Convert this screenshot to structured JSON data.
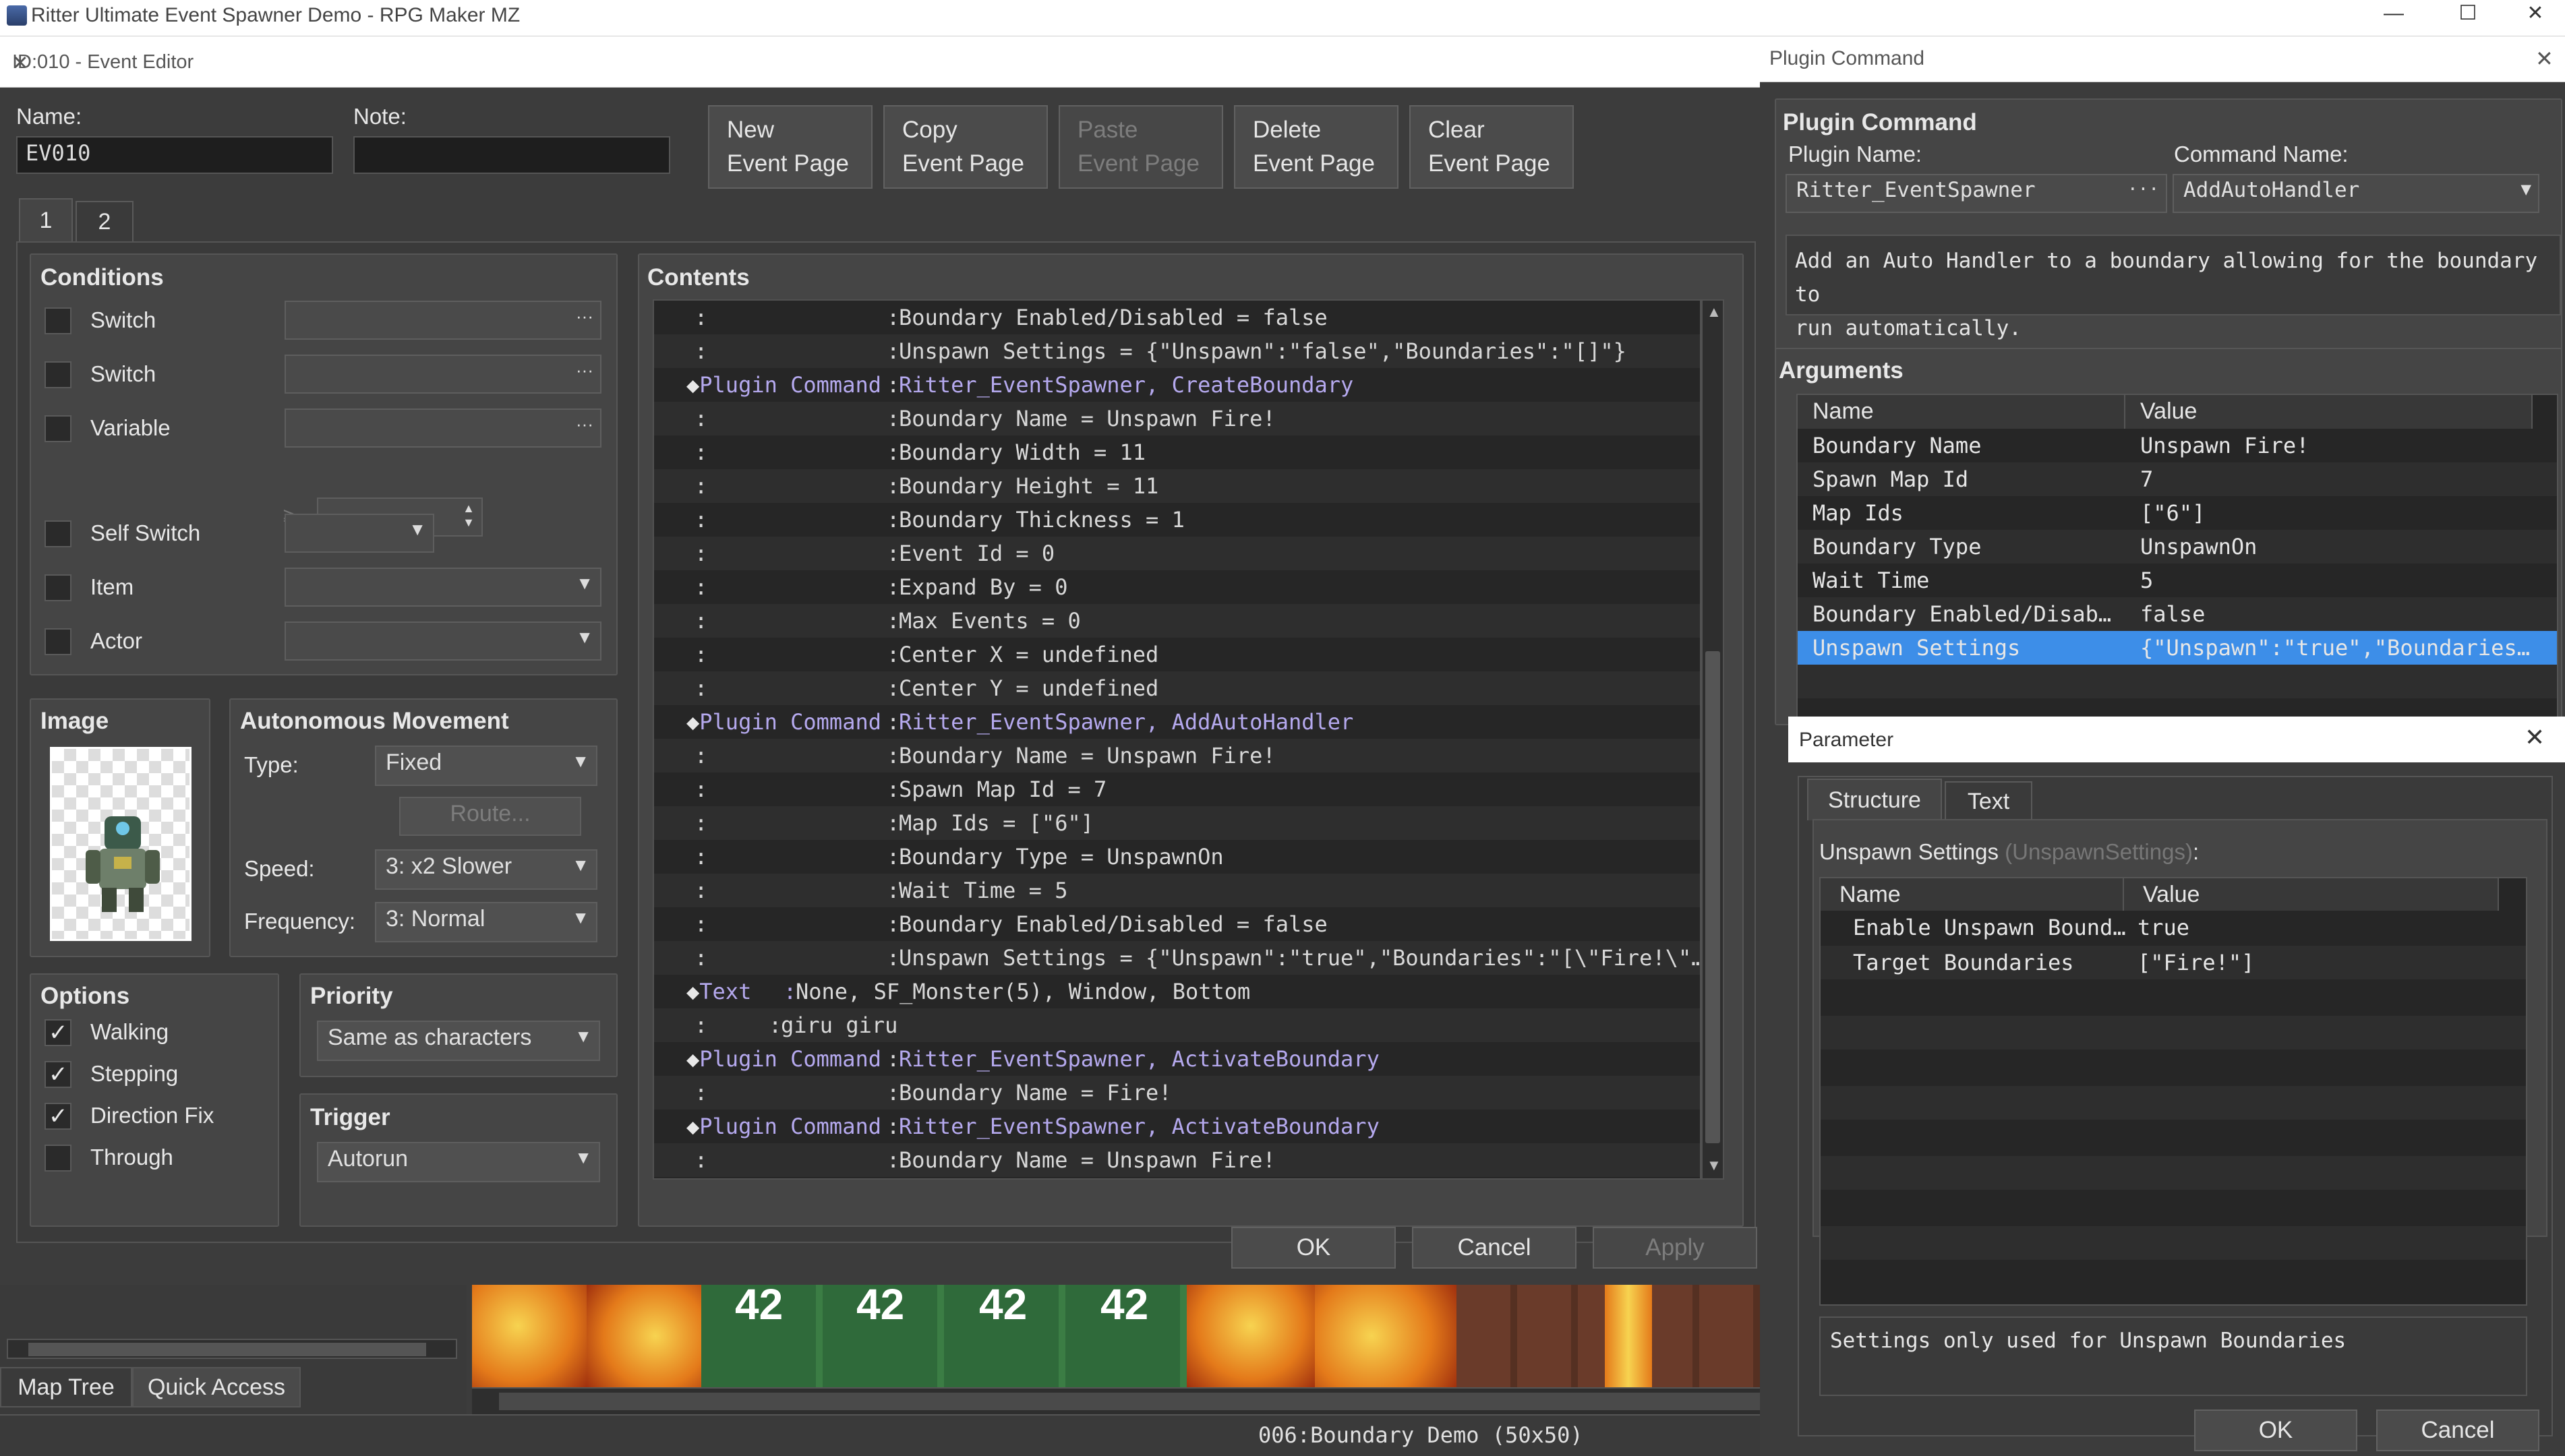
{
  "os_window": {
    "title": "Ritter Ultimate Event Spawner Demo - RPG Maker MZ",
    "minimize": "—",
    "maximize": "☐",
    "close": "✕"
  },
  "event_editor": {
    "title": "ID:010 - Event Editor",
    "close": "✕",
    "name_label": "Name:",
    "name_value": "EV010",
    "note_label": "Note:",
    "note_value": "",
    "page_buttons": [
      {
        "line1": "New",
        "line2": "Event Page",
        "enabled": true
      },
      {
        "line1": "Copy",
        "line2": "Event Page",
        "enabled": true
      },
      {
        "line1": "Paste",
        "line2": "Event Page",
        "enabled": false
      },
      {
        "line1": "Delete",
        "line2": "Event Page",
        "enabled": true
      },
      {
        "line1": "Clear",
        "line2": "Event Page",
        "enabled": true
      }
    ],
    "tabs": [
      "1",
      "2"
    ],
    "conditions": {
      "header": "Conditions",
      "items": [
        {
          "label": "Switch",
          "value": "",
          "icon": "ellipsis"
        },
        {
          "label": "Switch",
          "value": "",
          "icon": "ellipsis"
        },
        {
          "label": "Variable",
          "value": "",
          "icon": "ellipsis"
        },
        {
          "label": "Self Switch",
          "value": ""
        },
        {
          "label": "Item",
          "value": ""
        },
        {
          "label": "Actor",
          "value": ""
        }
      ],
      "variable_compare": "≥"
    },
    "image": {
      "header": "Image"
    },
    "autonomous_movement": {
      "header": "Autonomous Movement",
      "type_label": "Type:",
      "type_value": "Fixed",
      "route_button": "Route...",
      "speed_label": "Speed:",
      "speed_value": "3: x2 Slower",
      "frequency_label": "Frequency:",
      "frequency_value": "3: Normal"
    },
    "options": {
      "header": "Options",
      "items": [
        {
          "label": "Walking",
          "checked": true
        },
        {
          "label": "Stepping",
          "checked": true
        },
        {
          "label": "Direction Fix",
          "checked": true
        },
        {
          "label": "Through",
          "checked": false
        }
      ]
    },
    "priority": {
      "header": "Priority",
      "value": "Same as characters"
    },
    "trigger": {
      "header": "Trigger",
      "value": "Autorun"
    },
    "contents": {
      "header": "Contents",
      "rows": [
        {
          "kind": "arg",
          "text": "Boundary Enabled/Disabled = false"
        },
        {
          "kind": "arg",
          "text": "Unspawn Settings = {\"Unspawn\":\"false\",\"Boundaries\":\"[]\"}"
        },
        {
          "kind": "cmd",
          "cmd": "Plugin Command",
          "text": "Ritter_EventSpawner, CreateBoundary"
        },
        {
          "kind": "arg",
          "text": "Boundary Name = Unspawn Fire!"
        },
        {
          "kind": "arg",
          "text": "Boundary Width = 11"
        },
        {
          "kind": "arg",
          "text": "Boundary Height = 11"
        },
        {
          "kind": "arg",
          "text": "Boundary Thickness = 1"
        },
        {
          "kind": "arg",
          "text": "Event Id = 0"
        },
        {
          "kind": "arg",
          "text": "Expand By = 0"
        },
        {
          "kind": "arg",
          "text": "Max Events = 0"
        },
        {
          "kind": "arg",
          "text": "Center X = undefined"
        },
        {
          "kind": "arg",
          "text": "Center Y = undefined"
        },
        {
          "kind": "cmd",
          "cmd": "Plugin Command",
          "text": "Ritter_EventSpawner, AddAutoHandler"
        },
        {
          "kind": "arg",
          "text": "Boundary Name = Unspawn Fire!"
        },
        {
          "kind": "arg",
          "text": "Spawn Map Id = 7"
        },
        {
          "kind": "arg",
          "text": "Map Ids = [\"6\"]"
        },
        {
          "kind": "arg",
          "text": "Boundary Type = UnspawnOn"
        },
        {
          "kind": "arg",
          "text": "Wait Time = 5"
        },
        {
          "kind": "arg",
          "text": "Boundary Enabled/Disabled = false"
        },
        {
          "kind": "arg",
          "text": "Unspawn Settings = {\"Unspawn\":\"true\",\"Boundaries\":\"[\\\"Fire!\\\"…"
        },
        {
          "kind": "text",
          "cmd": "Text",
          "text": "None, SF_Monster(5), Window, Bottom"
        },
        {
          "kind": "textline",
          "text": "giru giru"
        },
        {
          "kind": "cmd",
          "cmd": "Plugin Command",
          "text": "Ritter_EventSpawner, ActivateBoundary"
        },
        {
          "kind": "arg",
          "text": "Boundary Name = Fire!"
        },
        {
          "kind": "cmd",
          "cmd": "Plugin Command",
          "text": "Ritter_EventSpawner, ActivateBoundary"
        },
        {
          "kind": "arg",
          "text": "Boundary Name = Unspawn Fire!"
        }
      ]
    },
    "ok": "OK",
    "cancel": "Cancel",
    "apply": "Apply"
  },
  "main_editor": {
    "tabs": [
      "Map Tree",
      "Quick Access"
    ],
    "tile_numbers": [
      "42",
      "42",
      "42",
      "42"
    ],
    "status": "006:Boundary Demo (50x50)"
  },
  "plugin_command": {
    "window_title": "Plugin Command",
    "close": "✕",
    "header": "Plugin Command",
    "plugin_name_label": "Plugin Name:",
    "plugin_name_value": "Ritter_EventSpawner",
    "command_name_label": "Command Name:",
    "command_name_value": "AddAutoHandler",
    "description_line1": "Add an Auto Handler to a boundary allowing for the boundary to",
    "description_line2": "run automatically.",
    "arguments_header": "Arguments",
    "col_name": "Name",
    "col_value": "Value",
    "arguments": [
      {
        "name": "Boundary Name",
        "value": "Unspawn Fire!"
      },
      {
        "name": "Spawn Map Id",
        "value": "7"
      },
      {
        "name": "Map Ids",
        "value": "[\"6\"]"
      },
      {
        "name": "Boundary Type",
        "value": "UnspawnOn"
      },
      {
        "name": "Wait Time",
        "value": "5"
      },
      {
        "name": "Boundary Enabled/Disab…",
        "value": "false"
      },
      {
        "name": "Unspawn Settings",
        "value": "{\"Unspawn\":\"true\",\"Boundaries…",
        "selected": true
      }
    ],
    "ok": "OK",
    "cancel": "Cancel"
  },
  "parameter": {
    "title": "Parameter",
    "close": "✕",
    "tabs": [
      "Structure",
      "Text"
    ],
    "field_label": "Unspawn Settings",
    "field_type": "(UnspawnSettings)",
    "field_colon": ":",
    "col_name": "Name",
    "col_value": "Value",
    "rows": [
      {
        "name": "Enable Unspawn Bound…",
        "value": "true"
      },
      {
        "name": "Target Boundaries",
        "value": "[\"Fire!\"]"
      }
    ],
    "description": "Settings only used for Unspawn Boundaries"
  },
  "colors": {
    "accent_selected": "#3d8ee8",
    "plugin_text": "#b5a9ee",
    "panel": "#454545"
  }
}
